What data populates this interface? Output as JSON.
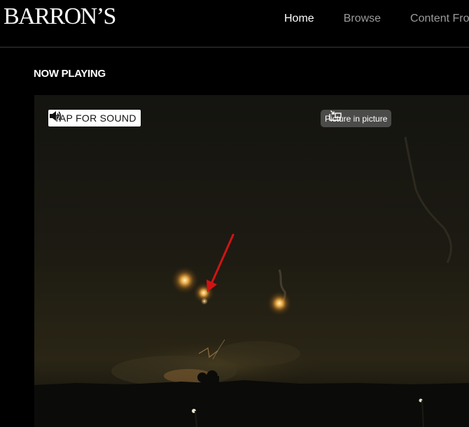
{
  "header": {
    "logo": "BARRON’S",
    "nav": [
      {
        "label": "Home",
        "active": true
      },
      {
        "label": "Browse",
        "active": false
      },
      {
        "label": "Content Fro",
        "active": false
      }
    ]
  },
  "section": {
    "title": "NOW PLAYING"
  },
  "video": {
    "tap_for_sound": "TAP FOR SOUND",
    "tap_icon": "speaker-icon",
    "pip_label": "Picture in picture",
    "pip_icon": "picture-in-picture-icon",
    "annotation_color": "#d01414"
  }
}
